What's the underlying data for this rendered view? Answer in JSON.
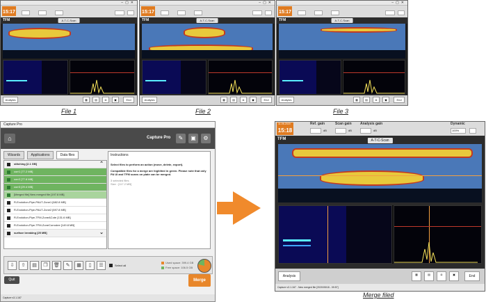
{
  "files": [
    {
      "time": "15:17",
      "caption": "File 1",
      "mode": "TFM",
      "tab": "A-T-C-Scan",
      "analysis": "Analysis",
      "end": "End"
    },
    {
      "time": "15:17",
      "caption": "File 2",
      "mode": "TFM",
      "tab": "A-T-C-Scan",
      "analysis": "Analysis",
      "end": "End"
    },
    {
      "time": "15:17",
      "caption": "File 3",
      "mode": "TFM",
      "tab": "A-T-C-Scan",
      "analysis": "Analysis",
      "end": "End"
    }
  ],
  "merged": {
    "date": "11-06-2020",
    "time": "15:18",
    "ref_gain_label": "Ref. gain",
    "scan_gain_label": "Scan gain",
    "analysis_gain_label": "Analysis gain",
    "db": "dB",
    "dynamic_label": "Dynamic",
    "dynamic_value": "100%",
    "mode": "TFM",
    "tab": "A-T-C-Scan",
    "analysis": "Analysis",
    "end": "End",
    "status": "Capture v3.1.167 - New merged file [2020/05/18 - 09:57]",
    "caption": "Merge filed"
  },
  "capture_pro": {
    "title": "Capture Pro",
    "header_title": "Capture Pro",
    "tabs": [
      "Wizards",
      "Applications",
      "Data files"
    ],
    "rows": [
      {
        "label": "stitching [2.1  GB]",
        "type": "grp"
      },
      {
        "label": "corr1 [77.2  MB]",
        "type": "sel"
      },
      {
        "label": "corr2 [77.8  MB]",
        "type": "sel"
      },
      {
        "label": "corr3 [29.4  MB]",
        "type": "sel"
      },
      {
        "label": "[Merged file] New merged file [197.8  MB]",
        "type": "selp"
      },
      {
        "label": "R-Evolution-Pipe-PAUT-Zone1 [682.8  MB]",
        "type": ""
      },
      {
        "label": "R-Evolution-Pipe-PAUT-Zone2 [697.8  MB]",
        "type": ""
      },
      {
        "label": "R-Evolution-Pipe-TFM-ZoneACote [131.6  MB]",
        "type": ""
      },
      {
        "label": "R-Evolution-Pipe-TFM-ZoneCorrodee [149.8  MB]",
        "type": ""
      },
      {
        "label": "surface breaking [25  MB]",
        "type": "grp"
      }
    ],
    "instructions_title": "Instructions",
    "instructions": "Select files to perform an action (move, delete, export).",
    "instructions2": "Compatible files for a merge are highlited in green. Please note that only PA UI and TFM scans on plate can be merged.",
    "selected_label": "3 selected files",
    "selected_size": "Size : [117.2 MB]",
    "select_all": "Select all",
    "used_space": "Used space: 399.4  GB",
    "free_space": "Free space: 106.5  GB",
    "quit": "Quit",
    "merge": "Merge",
    "status": "Capture v3.1.167",
    "used_fraction": 0.79,
    "colors": {
      "accent": "#e8872b",
      "selected": "#6fb460"
    }
  }
}
